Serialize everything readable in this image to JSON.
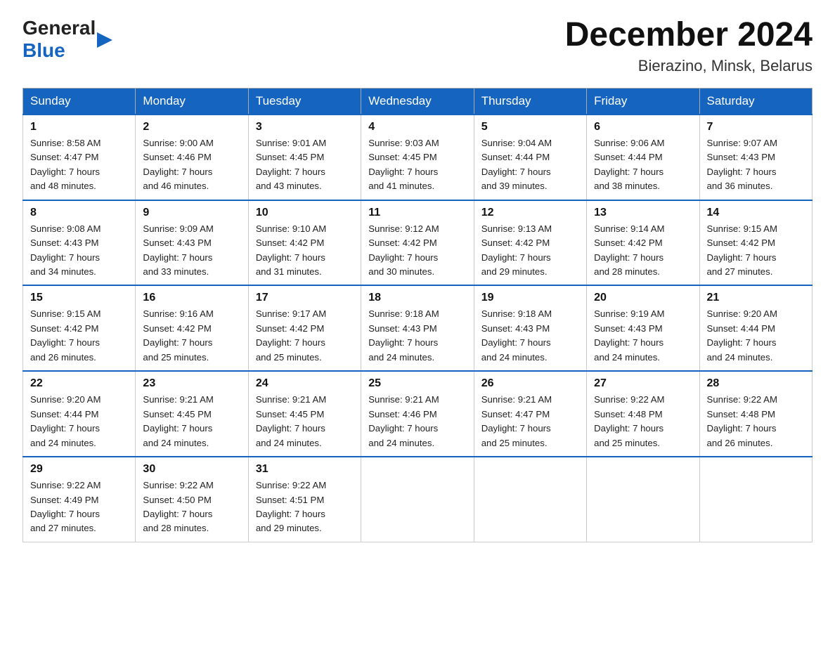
{
  "header": {
    "logo_general": "General",
    "logo_blue": "Blue",
    "month_title": "December 2024",
    "location": "Bierazino, Minsk, Belarus"
  },
  "days_of_week": [
    "Sunday",
    "Monday",
    "Tuesday",
    "Wednesday",
    "Thursday",
    "Friday",
    "Saturday"
  ],
  "weeks": [
    [
      {
        "day": "1",
        "sunrise": "8:58 AM",
        "sunset": "4:47 PM",
        "daylight": "7 hours and 48 minutes."
      },
      {
        "day": "2",
        "sunrise": "9:00 AM",
        "sunset": "4:46 PM",
        "daylight": "7 hours and 46 minutes."
      },
      {
        "day": "3",
        "sunrise": "9:01 AM",
        "sunset": "4:45 PM",
        "daylight": "7 hours and 43 minutes."
      },
      {
        "day": "4",
        "sunrise": "9:03 AM",
        "sunset": "4:45 PM",
        "daylight": "7 hours and 41 minutes."
      },
      {
        "day": "5",
        "sunrise": "9:04 AM",
        "sunset": "4:44 PM",
        "daylight": "7 hours and 39 minutes."
      },
      {
        "day": "6",
        "sunrise": "9:06 AM",
        "sunset": "4:44 PM",
        "daylight": "7 hours and 38 minutes."
      },
      {
        "day": "7",
        "sunrise": "9:07 AM",
        "sunset": "4:43 PM",
        "daylight": "7 hours and 36 minutes."
      }
    ],
    [
      {
        "day": "8",
        "sunrise": "9:08 AM",
        "sunset": "4:43 PM",
        "daylight": "7 hours and 34 minutes."
      },
      {
        "day": "9",
        "sunrise": "9:09 AM",
        "sunset": "4:43 PM",
        "daylight": "7 hours and 33 minutes."
      },
      {
        "day": "10",
        "sunrise": "9:10 AM",
        "sunset": "4:42 PM",
        "daylight": "7 hours and 31 minutes."
      },
      {
        "day": "11",
        "sunrise": "9:12 AM",
        "sunset": "4:42 PM",
        "daylight": "7 hours and 30 minutes."
      },
      {
        "day": "12",
        "sunrise": "9:13 AM",
        "sunset": "4:42 PM",
        "daylight": "7 hours and 29 minutes."
      },
      {
        "day": "13",
        "sunrise": "9:14 AM",
        "sunset": "4:42 PM",
        "daylight": "7 hours and 28 minutes."
      },
      {
        "day": "14",
        "sunrise": "9:15 AM",
        "sunset": "4:42 PM",
        "daylight": "7 hours and 27 minutes."
      }
    ],
    [
      {
        "day": "15",
        "sunrise": "9:15 AM",
        "sunset": "4:42 PM",
        "daylight": "7 hours and 26 minutes."
      },
      {
        "day": "16",
        "sunrise": "9:16 AM",
        "sunset": "4:42 PM",
        "daylight": "7 hours and 25 minutes."
      },
      {
        "day": "17",
        "sunrise": "9:17 AM",
        "sunset": "4:42 PM",
        "daylight": "7 hours and 25 minutes."
      },
      {
        "day": "18",
        "sunrise": "9:18 AM",
        "sunset": "4:43 PM",
        "daylight": "7 hours and 24 minutes."
      },
      {
        "day": "19",
        "sunrise": "9:18 AM",
        "sunset": "4:43 PM",
        "daylight": "7 hours and 24 minutes."
      },
      {
        "day": "20",
        "sunrise": "9:19 AM",
        "sunset": "4:43 PM",
        "daylight": "7 hours and 24 minutes."
      },
      {
        "day": "21",
        "sunrise": "9:20 AM",
        "sunset": "4:44 PM",
        "daylight": "7 hours and 24 minutes."
      }
    ],
    [
      {
        "day": "22",
        "sunrise": "9:20 AM",
        "sunset": "4:44 PM",
        "daylight": "7 hours and 24 minutes."
      },
      {
        "day": "23",
        "sunrise": "9:21 AM",
        "sunset": "4:45 PM",
        "daylight": "7 hours and 24 minutes."
      },
      {
        "day": "24",
        "sunrise": "9:21 AM",
        "sunset": "4:45 PM",
        "daylight": "7 hours and 24 minutes."
      },
      {
        "day": "25",
        "sunrise": "9:21 AM",
        "sunset": "4:46 PM",
        "daylight": "7 hours and 24 minutes."
      },
      {
        "day": "26",
        "sunrise": "9:21 AM",
        "sunset": "4:47 PM",
        "daylight": "7 hours and 25 minutes."
      },
      {
        "day": "27",
        "sunrise": "9:22 AM",
        "sunset": "4:48 PM",
        "daylight": "7 hours and 25 minutes."
      },
      {
        "day": "28",
        "sunrise": "9:22 AM",
        "sunset": "4:48 PM",
        "daylight": "7 hours and 26 minutes."
      }
    ],
    [
      {
        "day": "29",
        "sunrise": "9:22 AM",
        "sunset": "4:49 PM",
        "daylight": "7 hours and 27 minutes."
      },
      {
        "day": "30",
        "sunrise": "9:22 AM",
        "sunset": "4:50 PM",
        "daylight": "7 hours and 28 minutes."
      },
      {
        "day": "31",
        "sunrise": "9:22 AM",
        "sunset": "4:51 PM",
        "daylight": "7 hours and 29 minutes."
      },
      null,
      null,
      null,
      null
    ]
  ],
  "labels": {
    "sunrise": "Sunrise:",
    "sunset": "Sunset:",
    "daylight": "Daylight:"
  }
}
